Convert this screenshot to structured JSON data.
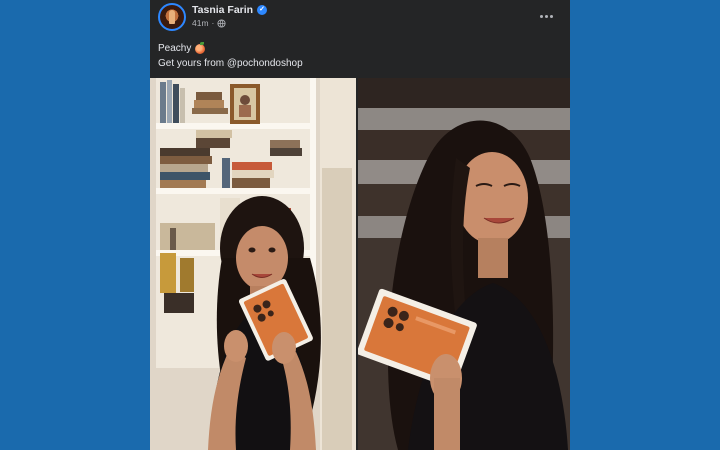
{
  "post": {
    "author": {
      "name": "Tasnia Farin",
      "verified_icon": "verified-badge-icon"
    },
    "meta": {
      "time": "41m",
      "separator": "·",
      "privacy_icon": "globe-icon"
    },
    "more_icon": "more-options-icon",
    "caption": {
      "line1": "Peachy",
      "line1_emoji": "peach-emoji",
      "line2": "Get yours from @pochondoshop"
    },
    "photos": [
      {
        "name": "photo-left",
        "description_icon": "photo"
      },
      {
        "name": "photo-right",
        "description_icon": "photo"
      }
    ]
  },
  "colors": {
    "page_background": "#1a6aad",
    "post_background": "#242526",
    "primary_text": "#e4e6eb",
    "secondary_text": "#b0b3b8",
    "verified_blue": "#2d88ff",
    "product_box_orange": "#d9773a"
  }
}
